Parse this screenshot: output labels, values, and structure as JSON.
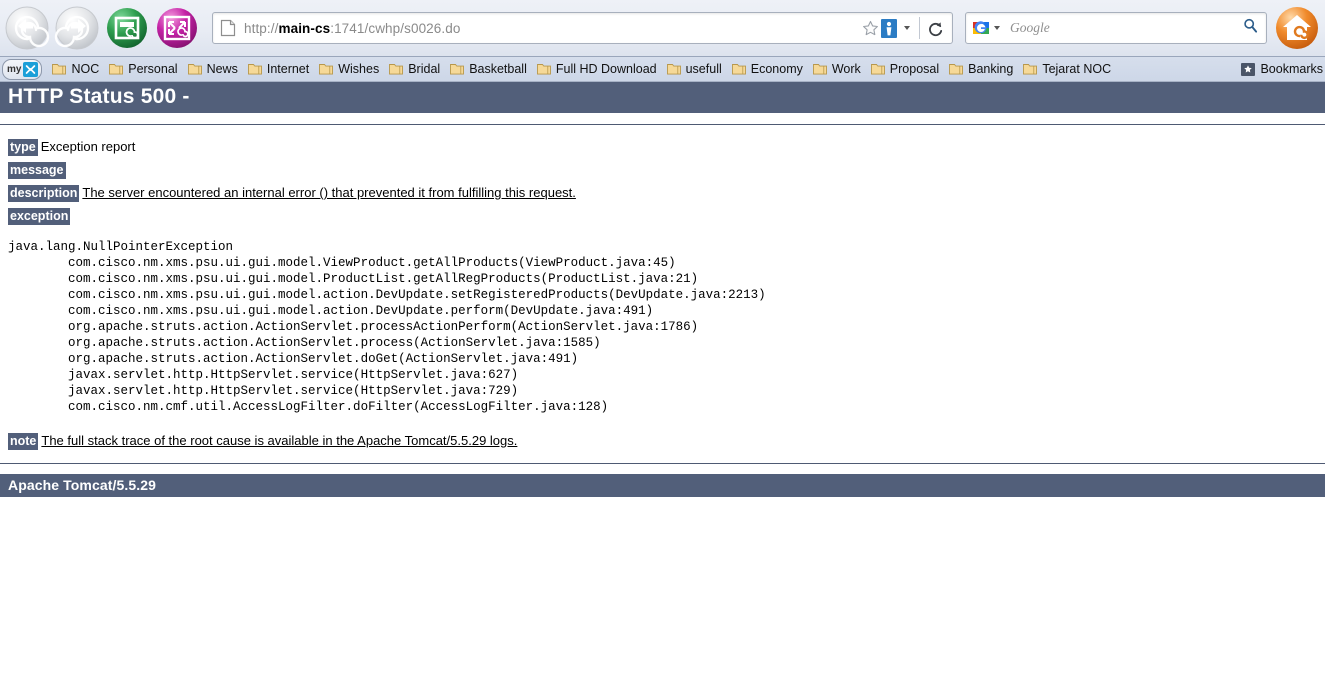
{
  "browser": {
    "back_label": "Back",
    "forward_label": "Forward",
    "window_label": "Window",
    "fullscreen_label": "Fullscreen",
    "url_scheme": "http://",
    "url_host": "main-cs",
    "url_rest": ":1741/cwhp/s0026.do",
    "url_full": "http://main-cs:1741/cwhp/s0026.do",
    "bookmark_star_label": "Bookmark this page",
    "identity_label": "Site identity",
    "reload_label": "Reload",
    "home_label": "Home",
    "search": {
      "engine": "Google",
      "placeholder": "Google",
      "search_icon": "magnifier-icon"
    }
  },
  "bookmarks_bar": {
    "my_badge": {
      "label": "my",
      "icon": "my-yahoo-icon"
    },
    "items": [
      {
        "label": "NOC",
        "icon": "folder-icon"
      },
      {
        "label": "Personal",
        "icon": "folder-icon"
      },
      {
        "label": "News",
        "icon": "folder-icon"
      },
      {
        "label": "Internet",
        "icon": "folder-icon"
      },
      {
        "label": "Wishes",
        "icon": "folder-icon"
      },
      {
        "label": "Bridal",
        "icon": "folder-icon"
      },
      {
        "label": "Basketball",
        "icon": "folder-icon"
      },
      {
        "label": "Full HD Download",
        "icon": "folder-icon"
      },
      {
        "label": "usefull",
        "icon": "folder-icon"
      },
      {
        "label": "Economy",
        "icon": "folder-icon"
      },
      {
        "label": "Work",
        "icon": "folder-icon"
      },
      {
        "label": "Proposal",
        "icon": "folder-icon"
      },
      {
        "label": "Banking",
        "icon": "folder-icon"
      },
      {
        "label": "Tejarat NOC",
        "icon": "folder-icon"
      }
    ],
    "right": {
      "label": "Bookmarks",
      "icon": "star-box-icon"
    }
  },
  "page": {
    "status_header": "HTTP Status 500 -",
    "rows": [
      {
        "tag": "type",
        "text": "Exception report",
        "underlined": false
      },
      {
        "tag": "message",
        "text": "",
        "underlined": false
      },
      {
        "tag": "description",
        "text": "The server encountered an internal error () that prevented it from fulfilling this request.",
        "underlined": true
      }
    ],
    "exception_tag": "exception",
    "stack_trace": "java.lang.NullPointerException\n\tcom.cisco.nm.xms.psu.ui.gui.model.ViewProduct.getAllProducts(ViewProduct.java:45)\n\tcom.cisco.nm.xms.psu.ui.gui.model.ProductList.getAllRegProducts(ProductList.java:21)\n\tcom.cisco.nm.xms.psu.ui.gui.model.action.DevUpdate.setRegisteredProducts(DevUpdate.java:2213)\n\tcom.cisco.nm.xms.psu.ui.gui.model.action.DevUpdate.perform(DevUpdate.java:491)\n\torg.apache.struts.action.ActionServlet.processActionPerform(ActionServlet.java:1786)\n\torg.apache.struts.action.ActionServlet.process(ActionServlet.java:1585)\n\torg.apache.struts.action.ActionServlet.doGet(ActionServlet.java:491)\n\tjavax.servlet.http.HttpServlet.service(HttpServlet.java:627)\n\tjavax.servlet.http.HttpServlet.service(HttpServlet.java:729)\n\tcom.cisco.nm.cmf.util.AccessLogFilter.doFilter(AccessLogFilter.java:128)",
    "note_tag": "note",
    "note_text": "The full stack trace of the root cause is available in the Apache Tomcat/5.5.29 logs.",
    "footer": "Apache Tomcat/5.5.29"
  },
  "colors": {
    "tomcat_slate": "#525f7a",
    "chrome_top": "#e8ecf4",
    "bookmarks_bar": "#d3dcea"
  }
}
